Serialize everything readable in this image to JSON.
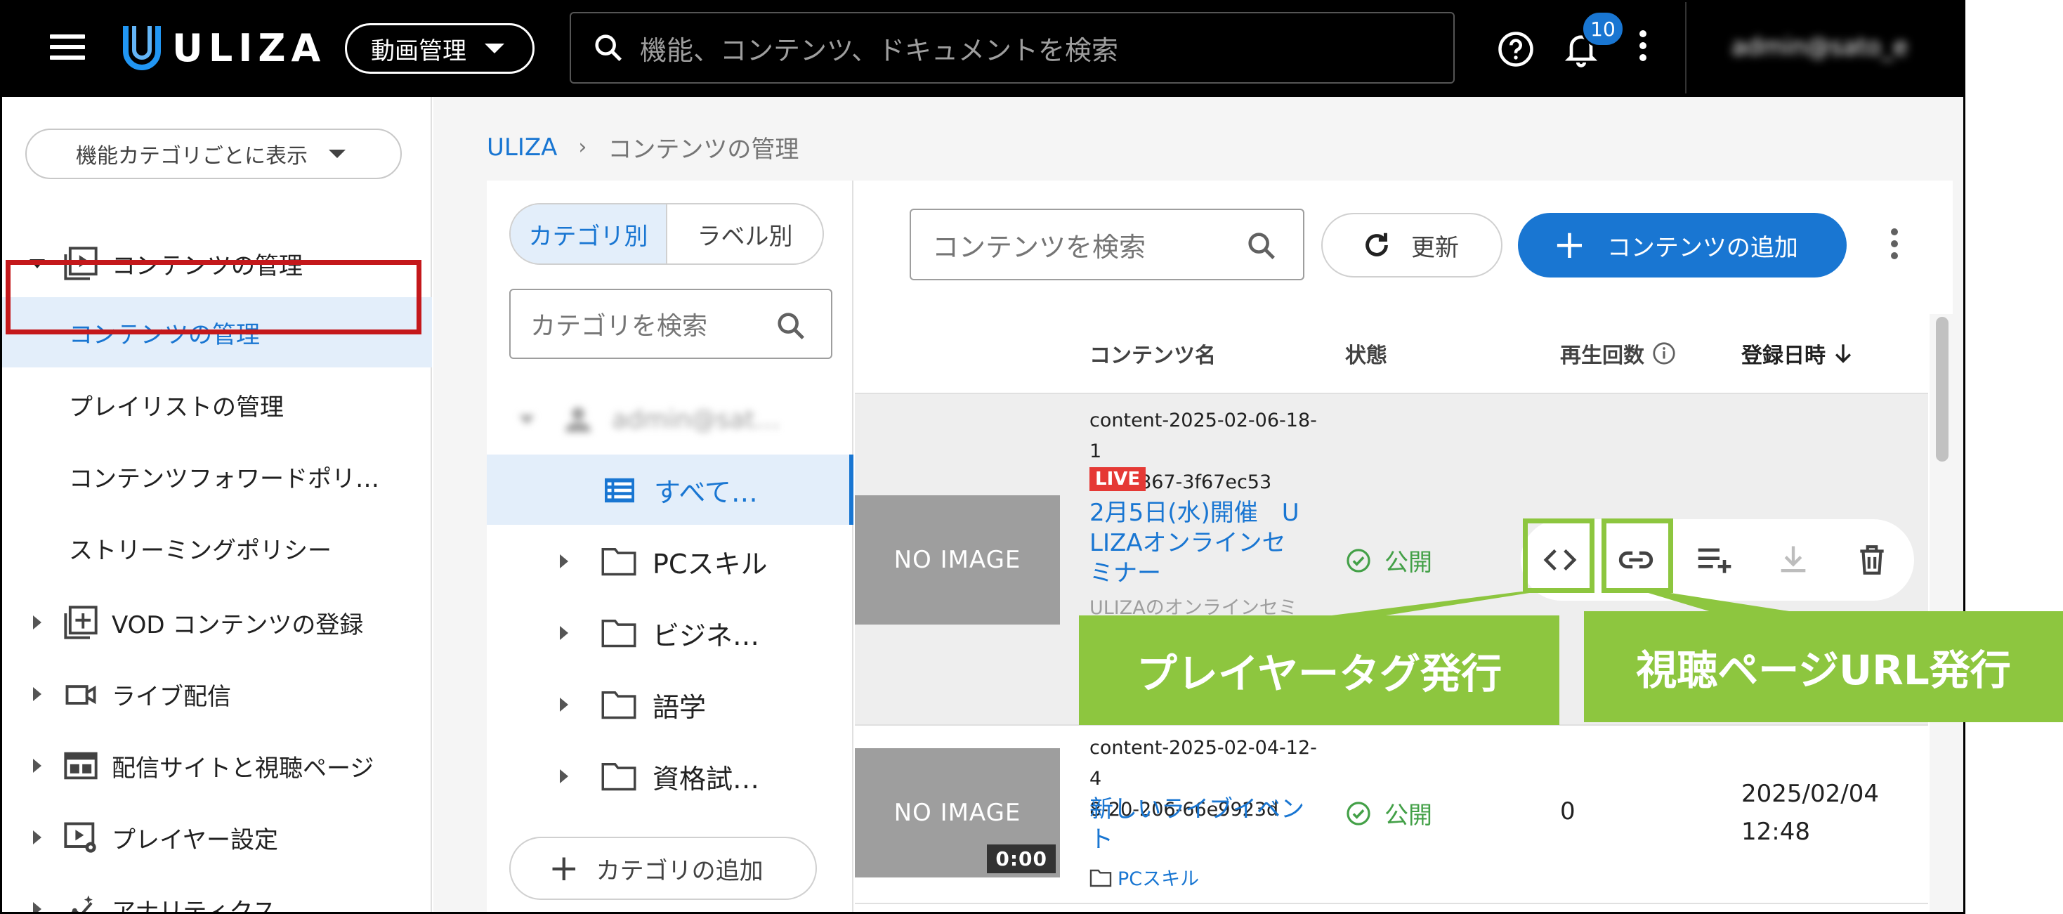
{
  "header": {
    "logo_text": "ULIZA",
    "menu_label": "動画管理",
    "search_placeholder": "機能、コンテンツ、ドキュメントを検索",
    "notification_count": "10",
    "user_name": "admin@sato_e"
  },
  "sidebar": {
    "category_select": "機能カテゴリごとに表示",
    "groups": [
      {
        "label": "コンテンツの管理",
        "icon": "play-box-icon",
        "expanded": true
      },
      {
        "label": "VOD コンテンツの登録",
        "icon": "add-box-icon"
      },
      {
        "label": "ライブ配信",
        "icon": "video-camera-icon"
      },
      {
        "label": "配信サイトと視聴ページ",
        "icon": "web-page-icon"
      },
      {
        "label": "プレイヤー設定",
        "icon": "player-settings-icon"
      },
      {
        "label": "アナリティクス",
        "icon": "analytics-icon"
      }
    ],
    "sub_items": [
      {
        "label": "コンテンツの管理",
        "active": true
      },
      {
        "label": "プレイリストの管理"
      },
      {
        "label": "コンテンツフォワードポリ…"
      },
      {
        "label": "ストリーミングポリシー"
      }
    ]
  },
  "breadcrumb": {
    "home": "ULIZA",
    "separator": "›",
    "current": "コンテンツの管理"
  },
  "category_panel": {
    "toggle": [
      "カテゴリ別",
      "ラベル別"
    ],
    "search_placeholder": "カテゴリを検索",
    "root_label": "admin@sat…",
    "items": [
      {
        "label": "すべて…",
        "icon": "list-icon",
        "selected": true
      },
      {
        "label": "PCスキル",
        "icon": "folder-icon"
      },
      {
        "label": "ビジネ…",
        "icon": "folder-icon"
      },
      {
        "label": "語学",
        "icon": "folder-icon"
      },
      {
        "label": "資格試…",
        "icon": "folder-icon"
      }
    ],
    "add_label": "カテゴリの追加"
  },
  "content_panel": {
    "search_placeholder": "コンテンツを検索",
    "refresh_label": "更新",
    "add_label": "コンテンツの追加",
    "columns": [
      "コンテンツ名",
      "状態",
      "再生回数",
      "登録日時"
    ],
    "rows": [
      {
        "thumbnail": "NO IMAGE",
        "id_line1": "content-2025-02-06-18-1",
        "id_line2": "5-54-867-3f67ec53",
        "live": "LIVE",
        "title_line1": "2月5日(水)開催　U",
        "title_line2": "LIZAオンラインセ",
        "title_line3": "ミナー",
        "subtitle": "ULIZAのオンラインセミ",
        "status": "公開"
      },
      {
        "thumbnail": "NO IMAGE",
        "duration": "0:00",
        "id_line1": "content-2025-02-04-12-4",
        "id_line2": "8-20-206-66e9923d",
        "title_line1": "新しいライブイベン",
        "title_line2": "ト",
        "folder": "PCスキル",
        "status": "公開",
        "plays": "0",
        "date": "2025/02/04",
        "time": "12:48"
      }
    ],
    "row_actions": [
      "code-icon",
      "link-icon",
      "playlist-add-icon",
      "download-icon",
      "delete-icon"
    ]
  },
  "callouts": {
    "player_tag": "プレイヤータグ発行",
    "page_url": "視聴ページURL発行"
  },
  "colors": {
    "accent": "#1976d2",
    "callout": "#8dc63f",
    "highlight_red": "#c4181b",
    "status_green": "#43a047",
    "live_red": "#e53935"
  }
}
